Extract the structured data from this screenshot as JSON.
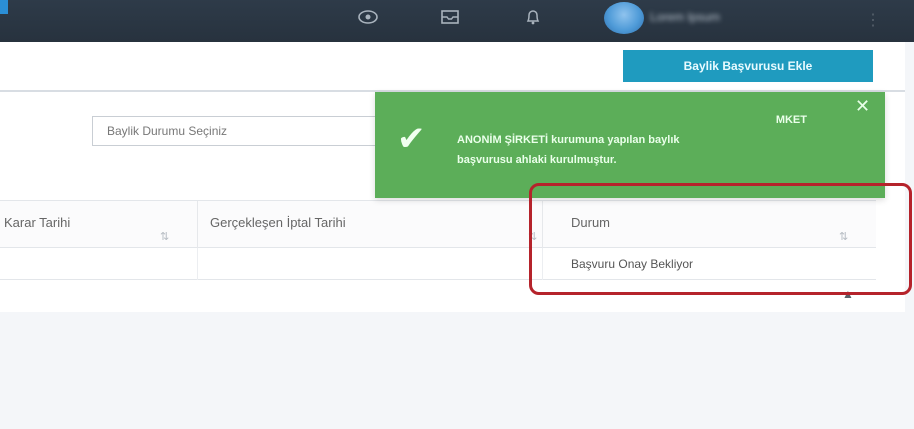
{
  "topbar": {
    "icons": [
      "eye-icon",
      "inbox-icon",
      "bell-icon"
    ],
    "user_name": "Lorem Ipsum"
  },
  "toolbar": {
    "add_button_label": "Baylik Başvurusu Ekle"
  },
  "filter": {
    "status_placeholder": "Baylik Durumu Seçiniz"
  },
  "toast": {
    "message_line1": "MKET",
    "message_line2": "ANONİM ŞİRKETİ kurumuna yapılan baylık",
    "message_line3": "başvurusu ahlaki kurulmuştur."
  },
  "grid": {
    "columns": [
      "Karar Tarihi",
      "Gerçekleşen İptal Tarihi",
      "Durum"
    ],
    "rows": [
      {
        "durum": "Başvuru Onay Bekliyor"
      }
    ]
  },
  "colors": {
    "topbar": "#2e3b49",
    "accent": "#1f9bbf",
    "toast": "#5cae59",
    "highlight": "#b5232b"
  }
}
